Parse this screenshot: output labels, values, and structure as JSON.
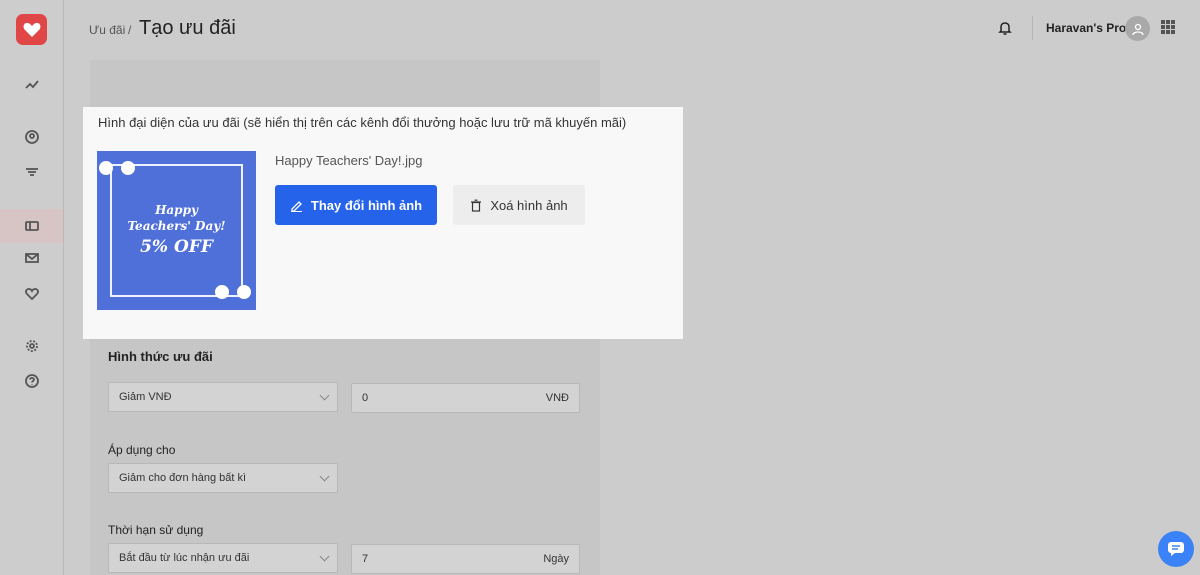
{
  "header": {
    "breadcrumb": "Ưu đãi",
    "separator": "/",
    "title": "Tạo ưu đãi",
    "store_name": "Haravan's Pro..."
  },
  "sidebar": {
    "items": [
      {
        "icon": "analytics-icon"
      },
      {
        "icon": "customer-icon"
      },
      {
        "icon": "filter-icon"
      },
      {
        "icon": "voucher-icon",
        "active": true
      },
      {
        "icon": "mail-icon"
      },
      {
        "icon": "heart-icon"
      },
      {
        "icon": "settings-icon"
      },
      {
        "icon": "help-icon"
      }
    ]
  },
  "image_section": {
    "label": "Hình đại diện của ưu đãi (sẽ hiển thị trên các kênh đổi thưởng hoặc lưu trữ mã khuyến mãi)",
    "file_name": "Happy Teachers' Day!.jpg",
    "change_button": "Thay đổi hình ảnh",
    "delete_button": "Xoá hình ảnh",
    "thumbnail": {
      "line1": "Happy",
      "line2": "Teachers' Day!",
      "line3": "5% OFF"
    }
  },
  "form": {
    "discount_type_title": "Hình thức ưu đãi",
    "discount_type_value": "Giảm VNĐ",
    "discount_amount": "0",
    "discount_unit": "VNĐ",
    "apply_title": "Áp dụng cho",
    "apply_value": "Giảm cho đơn hàng bất kì",
    "duration_title": "Thời hạn sử dụng",
    "duration_value": "Bắt đầu từ lúc nhận ưu đãi",
    "duration_amount": "7",
    "duration_unit": "Ngày"
  },
  "colors": {
    "primary": "#2563eb",
    "brand": "#e04646",
    "chat": "#3b82f6"
  }
}
